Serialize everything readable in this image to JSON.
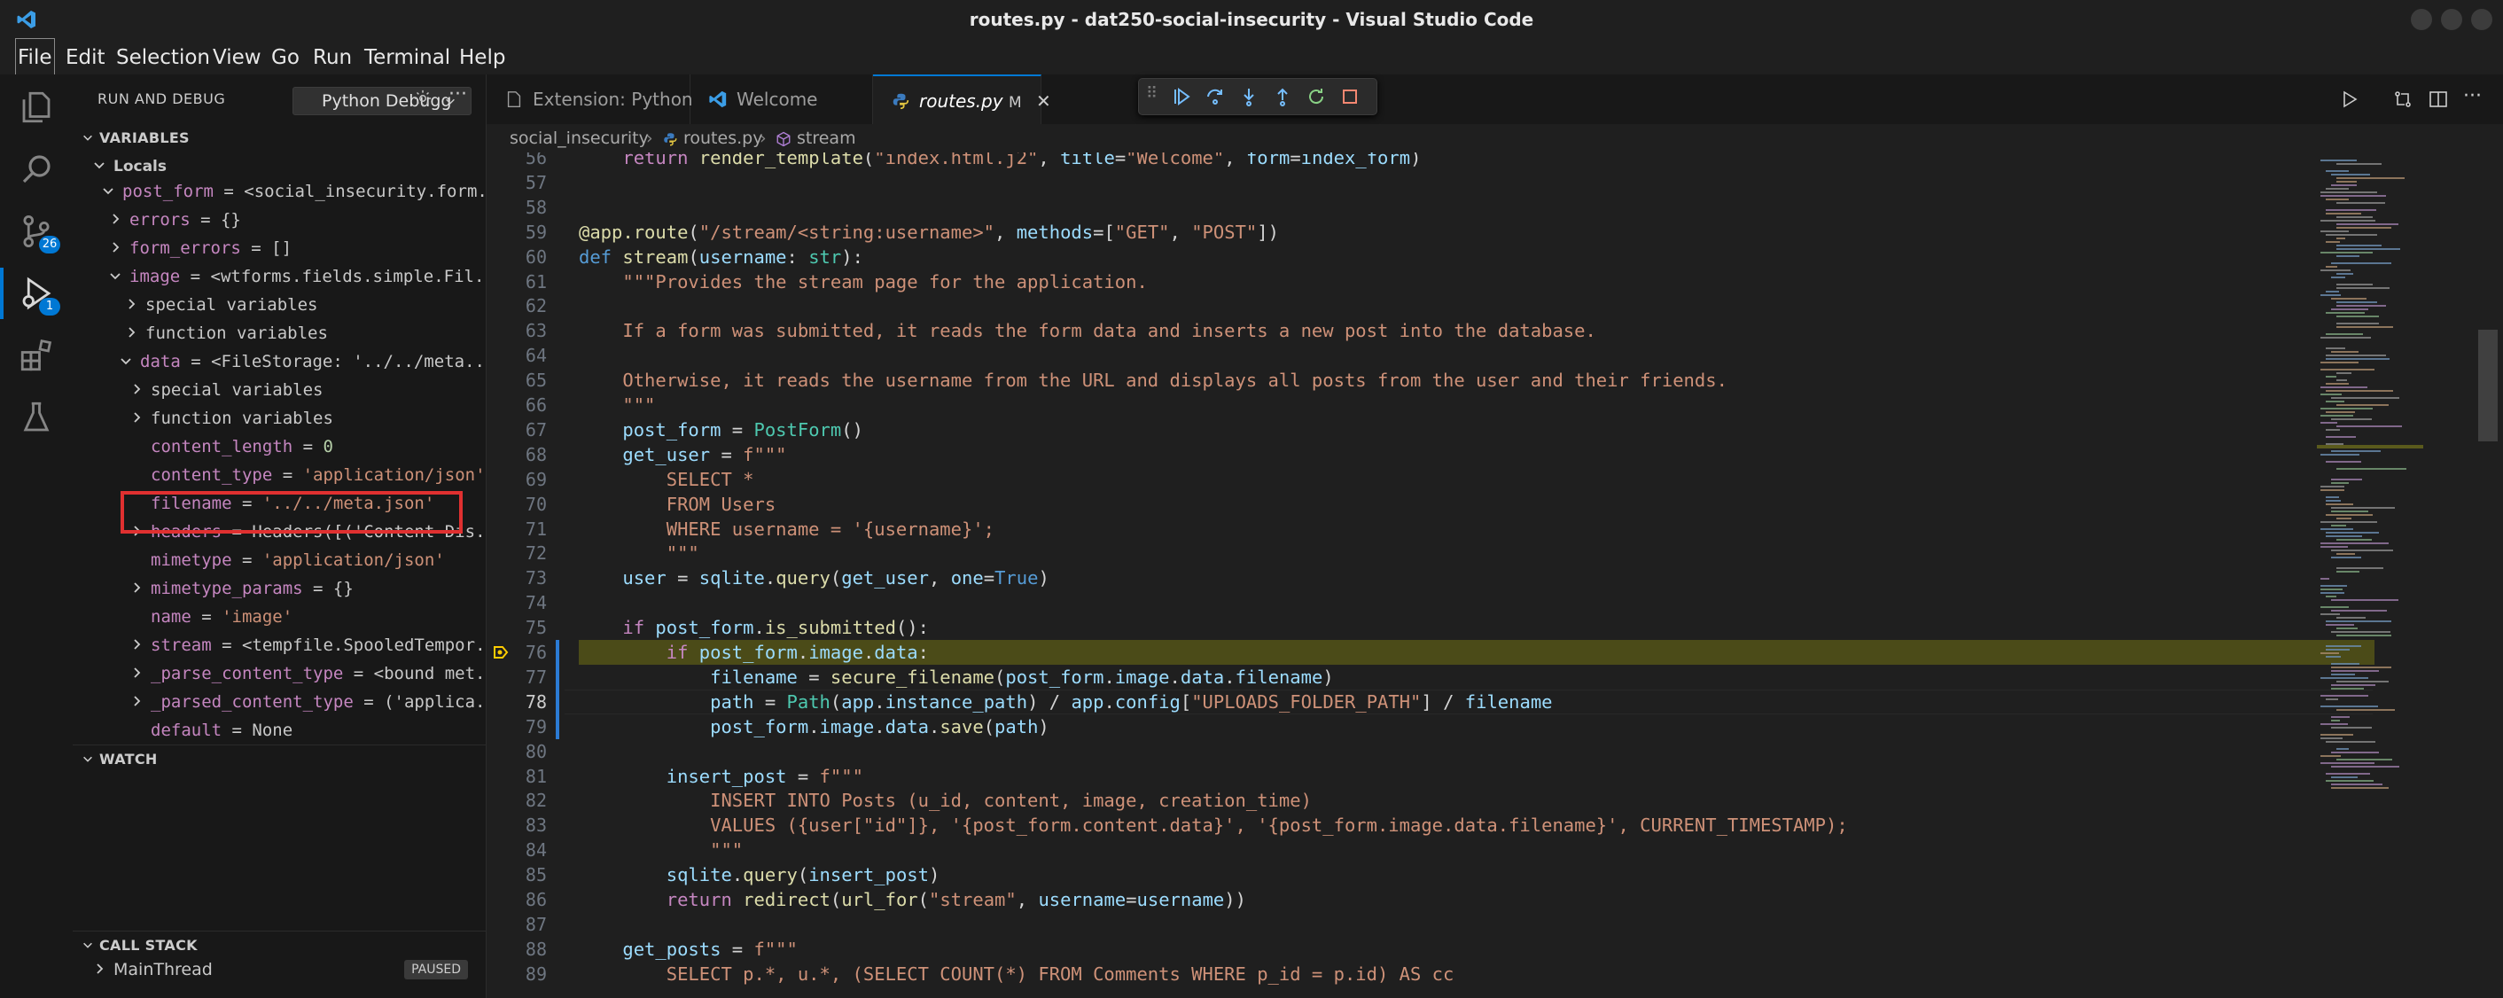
{
  "window": {
    "title": "routes.py - dat250-social-insecurity - Visual Studio Code"
  },
  "menu": [
    "File",
    "Edit",
    "Selection",
    "View",
    "Go",
    "Run",
    "Terminal",
    "Help"
  ],
  "activity": {
    "source_control_badge": "26",
    "debug_badge": "1"
  },
  "sidebar": {
    "title": "RUN AND DEBUG",
    "config": "Python Debugg",
    "sections": {
      "variables": "VARIABLES",
      "watch": "WATCH",
      "call_stack": "CALL STACK"
    },
    "locals": "Locals",
    "vars": [
      {
        "name": "post_form",
        "value": "<social_insecurity.form..."
      },
      {
        "name": "errors",
        "value": "{}"
      },
      {
        "name": "form_errors",
        "value": "[]"
      },
      {
        "name": "image",
        "value": "<wtforms.fields.simple.Fil..."
      },
      {
        "name": "special variables",
        "value": ""
      },
      {
        "name": "function variables",
        "value": ""
      },
      {
        "name": "data",
        "value": "<FileStorage: '../../meta..."
      },
      {
        "name": "special variables",
        "value": ""
      },
      {
        "name": "function variables",
        "value": ""
      },
      {
        "name": "content_length",
        "value": "0"
      },
      {
        "name": "content_type",
        "value": "'application/json'"
      },
      {
        "name": "filename",
        "value": "'../../meta.json'"
      },
      {
        "name": "headers",
        "value": "Headers([('Content-Dis..."
      },
      {
        "name": "mimetype",
        "value": "'application/json'"
      },
      {
        "name": "mimetype_params",
        "value": "{}"
      },
      {
        "name": "name",
        "value": "'image'"
      },
      {
        "name": "stream",
        "value": "<tempfile.SpooledTempor..."
      },
      {
        "name": "_parse_content_type",
        "value": "<bound met..."
      },
      {
        "name": "_parsed_content_type",
        "value": "('applica..."
      },
      {
        "name": "default",
        "value": "None"
      }
    ],
    "call_stack": {
      "thread": "MainThread",
      "status": "PAUSED"
    }
  },
  "tabs": [
    {
      "label": "Extension: Python"
    },
    {
      "label": "Welcome"
    },
    {
      "label": "routes.py",
      "modified": "M"
    }
  ],
  "breadcrumb": [
    "social_insecurity",
    "routes.py",
    "stream"
  ],
  "editor": {
    "lines": [
      {
        "n": "56",
        "text": "    return render_template(\"index.html.j2\", title=\"Welcome\", form=index_form)"
      },
      {
        "n": "57",
        "text": ""
      },
      {
        "n": "58",
        "text": ""
      },
      {
        "n": "59",
        "text": "@app.route(\"/stream/<string:username>\", methods=[\"GET\", \"POST\"])"
      },
      {
        "n": "60",
        "text": "def stream(username: str):"
      },
      {
        "n": "61",
        "text": "    \"\"\"Provides the stream page for the application."
      },
      {
        "n": "62",
        "text": ""
      },
      {
        "n": "63",
        "text": "    If a form was submitted, it reads the form data and inserts a new post into the database."
      },
      {
        "n": "64",
        "text": ""
      },
      {
        "n": "65",
        "text": "    Otherwise, it reads the username from the URL and displays all posts from the user and their friends."
      },
      {
        "n": "66",
        "text": "    \"\"\""
      },
      {
        "n": "67",
        "text": "    post_form = PostForm()"
      },
      {
        "n": "68",
        "text": "    get_user = f\"\"\""
      },
      {
        "n": "69",
        "text": "        SELECT *"
      },
      {
        "n": "70",
        "text": "        FROM Users"
      },
      {
        "n": "71",
        "text": "        WHERE username = '{username}';"
      },
      {
        "n": "72",
        "text": "        \"\"\""
      },
      {
        "n": "73",
        "text": "    user = sqlite.query(get_user, one=True)"
      },
      {
        "n": "74",
        "text": ""
      },
      {
        "n": "75",
        "text": "    if post_form.is_submitted():"
      },
      {
        "n": "76",
        "text": "        if post_form.image.data:"
      },
      {
        "n": "77",
        "text": "            filename = secure_filename(post_form.image.data.filename)"
      },
      {
        "n": "78",
        "text": "            path = Path(app.instance_path) / app.config[\"UPLOADS_FOLDER_PATH\"] / filename"
      },
      {
        "n": "79",
        "text": "            post_form.image.data.save(path)"
      },
      {
        "n": "80",
        "text": ""
      },
      {
        "n": "81",
        "text": "        insert_post = f\"\"\""
      },
      {
        "n": "82",
        "text": "            INSERT INTO Posts (u_id, content, image, creation_time)"
      },
      {
        "n": "83",
        "text": "            VALUES ({user[\"id\"]}, '{post_form.content.data}', '{post_form.image.data.filename}', CURRENT_TIMESTAMP);"
      },
      {
        "n": "84",
        "text": "            \"\"\""
      },
      {
        "n": "85",
        "text": "        sqlite.query(insert_post)"
      },
      {
        "n": "86",
        "text": "        return redirect(url_for(\"stream\", username=username))"
      },
      {
        "n": "87",
        "text": ""
      },
      {
        "n": "88",
        "text": "    get_posts = f\"\"\""
      },
      {
        "n": "89",
        "text": "        SELECT p.*, u.*, (SELECT COUNT(*) FROM Comments WHERE p_id = p.id) AS cc"
      }
    ]
  }
}
